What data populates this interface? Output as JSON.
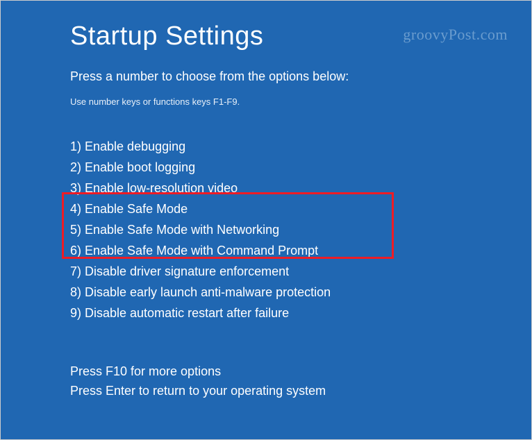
{
  "title": "Startup Settings",
  "subtitle": "Press a number to choose from the options below:",
  "hint": "Use number keys or functions keys F1-F9.",
  "options": [
    "1) Enable debugging",
    "2) Enable boot logging",
    "3) Enable low-resolution video",
    "4) Enable Safe Mode",
    "5) Enable Safe Mode with Networking",
    "6) Enable Safe Mode with Command Prompt",
    "7) Disable driver signature enforcement",
    "8) Disable early launch anti-malware protection",
    "9) Disable automatic restart after failure"
  ],
  "footer": {
    "more": "Press F10 for more options",
    "return": "Press Enter to return to your operating system"
  },
  "watermark": "groovyPost.com"
}
